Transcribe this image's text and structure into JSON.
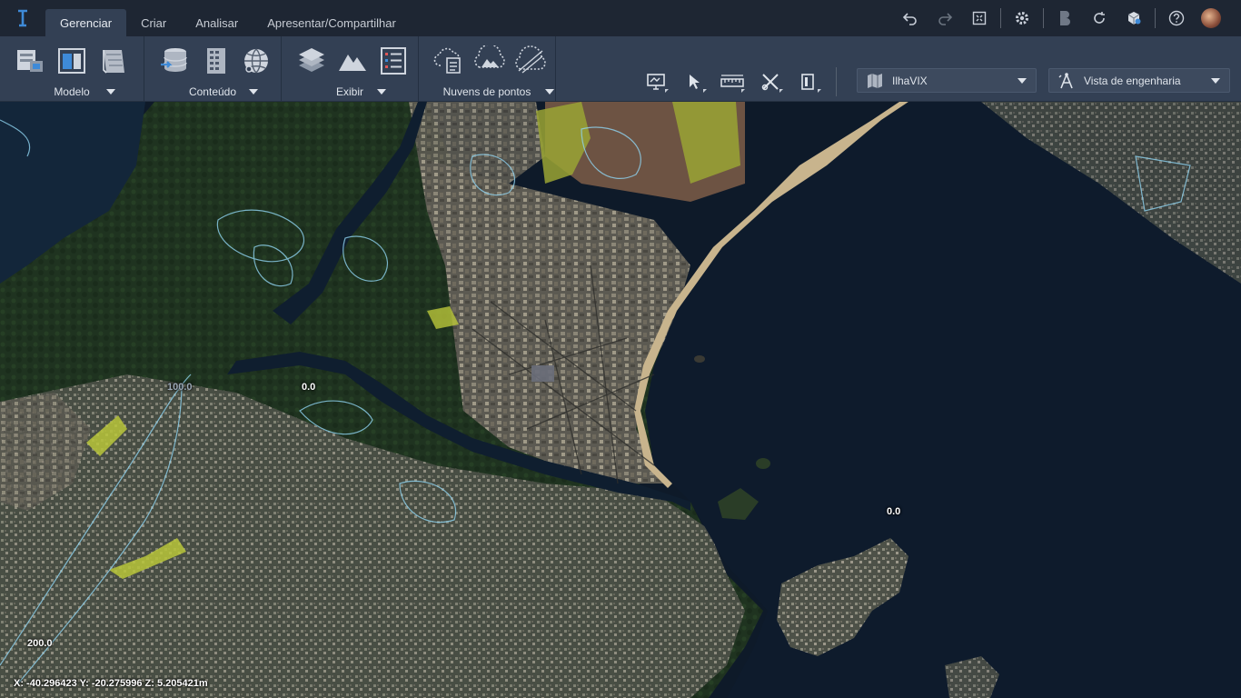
{
  "app": {
    "logo_icon": "itwin-logo-icon"
  },
  "tabs": [
    {
      "label": "Gerenciar",
      "active": true
    },
    {
      "label": "Criar",
      "active": false
    },
    {
      "label": "Analisar",
      "active": false
    },
    {
      "label": "Apresentar/Compartilhar",
      "active": false
    }
  ],
  "top_right_icons": [
    "undo-icon",
    "redo-icon",
    "fit-view-icon",
    "settings-icon",
    "bentley-b-icon",
    "refresh-icon",
    "model-cube-icon",
    "help-icon",
    "user-avatar"
  ],
  "ribbon": {
    "groups": [
      {
        "label": "Modelo",
        "icons": [
          "model-properties-icon",
          "layout-view-icon",
          "sheet-drawing-icon"
        ]
      },
      {
        "label": "Conteúdo",
        "icons": [
          "database-import-icon",
          "building-grid-icon",
          "globe-network-icon"
        ]
      },
      {
        "label": "Exibir",
        "icons": [
          "layers-icon",
          "terrain-mountains-icon",
          "list-legend-icon"
        ]
      },
      {
        "label": "Nuvens de pontos",
        "icons": [
          "cloud-list-icon",
          "cloud-terrain-icon",
          "cloud-crop-icon"
        ]
      }
    ],
    "tools": [
      "monitor-icon",
      "select-pointer-icon",
      "measure-ruler-icon",
      "tools-cross-icon",
      "clip-box-icon"
    ],
    "project_select": {
      "value": "IlhaVIX",
      "icon": "map-sheet-icon"
    },
    "view_select": {
      "value": "Vista de engenharia",
      "icon": "engineering-view-icon"
    }
  },
  "map": {
    "contour_labels": [
      {
        "text": "0.0",
        "variant": "bright"
      },
      {
        "text": "100.0",
        "variant": "dim"
      },
      {
        "text": "0.0",
        "variant": "bright"
      },
      {
        "text": "200.0",
        "variant": "bright"
      }
    ],
    "coordinates": "X: -40.296423 Y: -20.275996 Z: 5.205421m"
  }
}
